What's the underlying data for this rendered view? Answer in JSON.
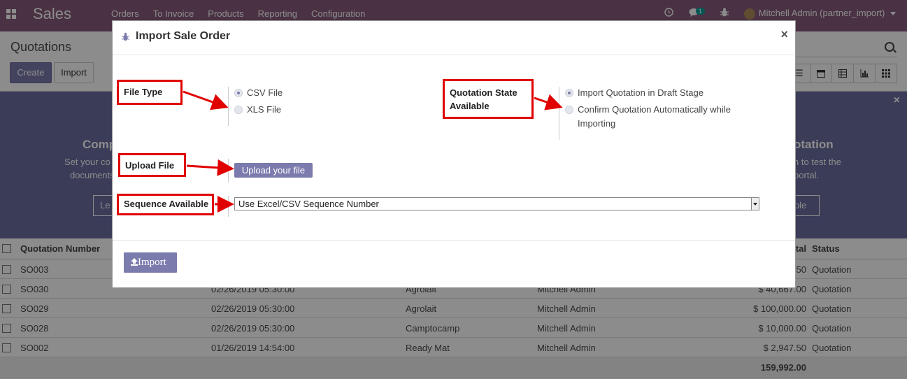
{
  "navbar": {
    "brand": "Sales",
    "menu": [
      "Orders",
      "To Invoice",
      "Products",
      "Reporting",
      "Configuration"
    ],
    "chat_count": "1",
    "user": "Mitchell Admin (partner_import)"
  },
  "control_panel": {
    "title": "Quotations",
    "create_label": "Create",
    "import_label": "Import"
  },
  "banner": {
    "left_title": "Comp",
    "left_text1": "Set your co",
    "left_text2": "documents",
    "left_button": "Le",
    "right_title": "otation",
    "right_text1": "n to test the",
    "right_text2": "portal.",
    "right_button": "mple"
  },
  "table": {
    "headers": {
      "number": "Quotation Number",
      "total": "tal",
      "status": "Status"
    },
    "rows": [
      {
        "number": "SO003",
        "date": "",
        "customer": "",
        "salesperson": "",
        "total": "50",
        "status": "Quotation"
      },
      {
        "number": "SO030",
        "date": "02/26/2019 05:30:00",
        "customer": "Agrolait",
        "salesperson": "Mitchell Admin",
        "total": "$ 40,667.00",
        "status": "Quotation"
      },
      {
        "number": "SO029",
        "date": "02/26/2019 05:30:00",
        "customer": "Agrolait",
        "salesperson": "Mitchell Admin",
        "total": "$ 100,000.00",
        "status": "Quotation"
      },
      {
        "number": "SO028",
        "date": "02/26/2019 05:30:00",
        "customer": "Camptocamp",
        "salesperson": "Mitchell Admin",
        "total": "$ 10,000.00",
        "status": "Quotation"
      },
      {
        "number": "SO002",
        "date": "01/26/2019 14:54:00",
        "customer": "Ready Mat",
        "salesperson": "Mitchell Admin",
        "total": "$ 2,947.50",
        "status": "Quotation"
      }
    ],
    "footer_total": "159,992.00"
  },
  "modal": {
    "title": "Import Sale Order",
    "file_type": {
      "label": "File Type",
      "options": [
        "CSV File",
        "XLS File"
      ],
      "selected": "CSV File"
    },
    "quotation_state": {
      "label_line1": "Quotation State",
      "label_line2": "Available",
      "options": [
        "Import Quotation in Draft Stage",
        "Confirm Quotation Automatically while",
        "Importing"
      ],
      "selected": "Import Quotation in Draft Stage"
    },
    "upload": {
      "label": "Upload File",
      "button": "Upload your file"
    },
    "sequence": {
      "label": "Sequence Available",
      "value": "Use Excel/CSV Sequence Number"
    },
    "import_button": "Import"
  },
  "colors": {
    "navbar": "#875a7b",
    "primary": "#7c7bad",
    "annotation": "#e00000"
  }
}
